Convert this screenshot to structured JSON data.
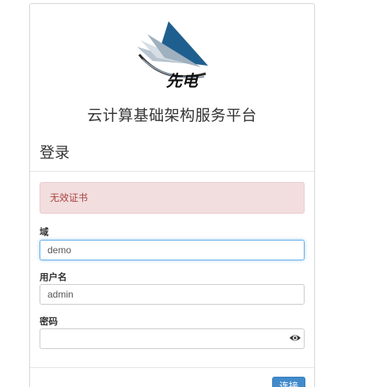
{
  "header": {
    "logo_text": "先电",
    "platform_title": "云计算基础架构服务平台"
  },
  "login": {
    "heading": "登录",
    "alert_message": "无效证书",
    "domain": {
      "label": "域",
      "value": "demo"
    },
    "username": {
      "label": "用户名",
      "value": "admin"
    },
    "password": {
      "label": "密码",
      "value": "",
      "toggle_icon": "eye-icon"
    },
    "submit_label": "连接"
  },
  "colors": {
    "alert_bg": "#f2dede",
    "alert_text": "#a94442",
    "primary_button": "#428bca",
    "focus_border": "#66afe9"
  }
}
